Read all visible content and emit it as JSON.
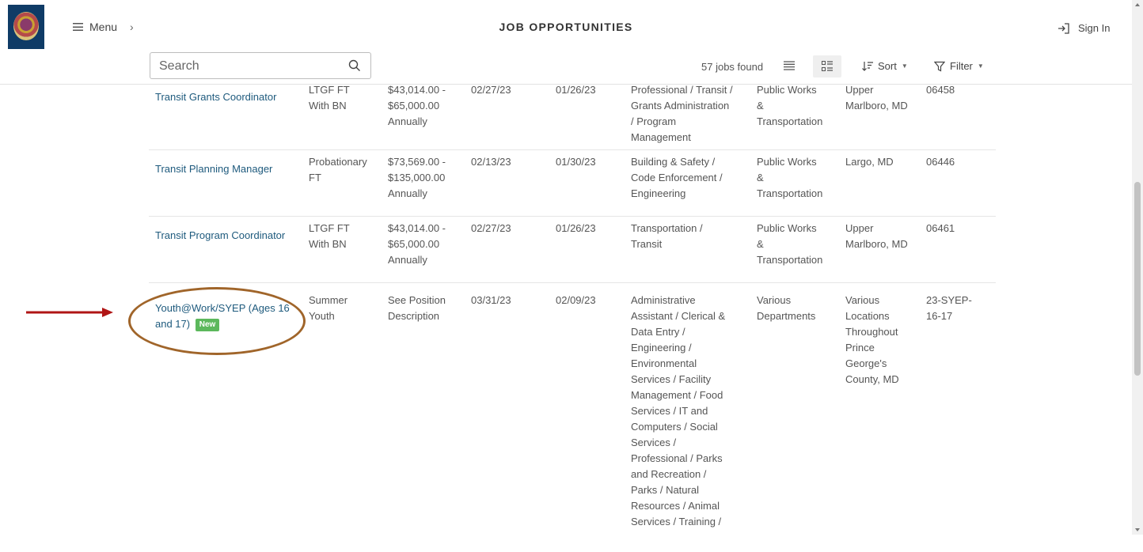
{
  "header": {
    "menu_label": "Menu",
    "title": "JOB OPPORTUNITIES",
    "sign_in_label": "Sign In"
  },
  "toolbar": {
    "search_placeholder": "Search",
    "jobs_found": "57 jobs found",
    "sort_label": "Sort",
    "filter_label": "Filter"
  },
  "jobs": [
    {
      "title": "Transit Grants Coordinator",
      "type": [
        "LTGF FT",
        "With BN"
      ],
      "salary": [
        "$43,014.00 -",
        "$65,000.00",
        "Annually"
      ],
      "closing": "02/27/23",
      "posted": "01/26/23",
      "category": [
        "Professional / Transit /",
        "Grants Administration",
        "/ Program",
        "Management"
      ],
      "department": [
        "Public Works",
        "&",
        "Transportation"
      ],
      "location": [
        "Upper",
        "Marlboro, MD"
      ],
      "number": [
        "06458"
      ]
    },
    {
      "title": "Transit Planning Manager",
      "type": [
        "Probationary",
        "FT"
      ],
      "salary": [
        "$73,569.00 -",
        "$135,000.00",
        "Annually"
      ],
      "closing": "02/13/23",
      "posted": "01/30/23",
      "category": [
        "Building & Safety /",
        "Code Enforcement /",
        "Engineering"
      ],
      "department": [
        "Public Works",
        "&",
        "Transportation"
      ],
      "location": [
        "Largo, MD"
      ],
      "number": [
        "06446"
      ]
    },
    {
      "title": "Transit Program Coordinator",
      "type": [
        "LTGF FT",
        "With BN"
      ],
      "salary": [
        "$43,014.00 -",
        "$65,000.00",
        "Annually"
      ],
      "closing": "02/27/23",
      "posted": "01/26/23",
      "category": [
        "Transportation /",
        "Transit"
      ],
      "department": [
        "Public Works",
        "&",
        "Transportation"
      ],
      "location": [
        "Upper",
        "Marlboro, MD"
      ],
      "number": [
        "06461"
      ]
    },
    {
      "title_lines": [
        "Youth@Work/SYEP (Ages 16",
        "and 17)"
      ],
      "badge": "New",
      "type": [
        "Summer",
        "Youth"
      ],
      "salary": [
        "See Position",
        "Description"
      ],
      "closing": "03/31/23",
      "posted": "02/09/23",
      "category": [
        "Administrative",
        "Assistant / Clerical &",
        "Data Entry /",
        "Engineering /",
        "Environmental",
        "Services / Facility",
        "Management / Food",
        "Services / IT and",
        "Computers / Social",
        "Services /",
        "Professional / Parks",
        "and Recreation /",
        "Parks / Natural",
        "Resources / Animal",
        "Services / Training /"
      ],
      "department": [
        "Various",
        "Departments"
      ],
      "location": [
        "Various",
        "Locations",
        "Throughout",
        "Prince",
        "George's",
        "County, MD"
      ],
      "number": [
        "23-SYEP-",
        "16-17"
      ]
    }
  ],
  "colors": {
    "link": "#1e5a7d",
    "badge": "#5cb85c",
    "annotation_arrow": "#b01515",
    "annotation_ellipse": "#a0652a"
  }
}
